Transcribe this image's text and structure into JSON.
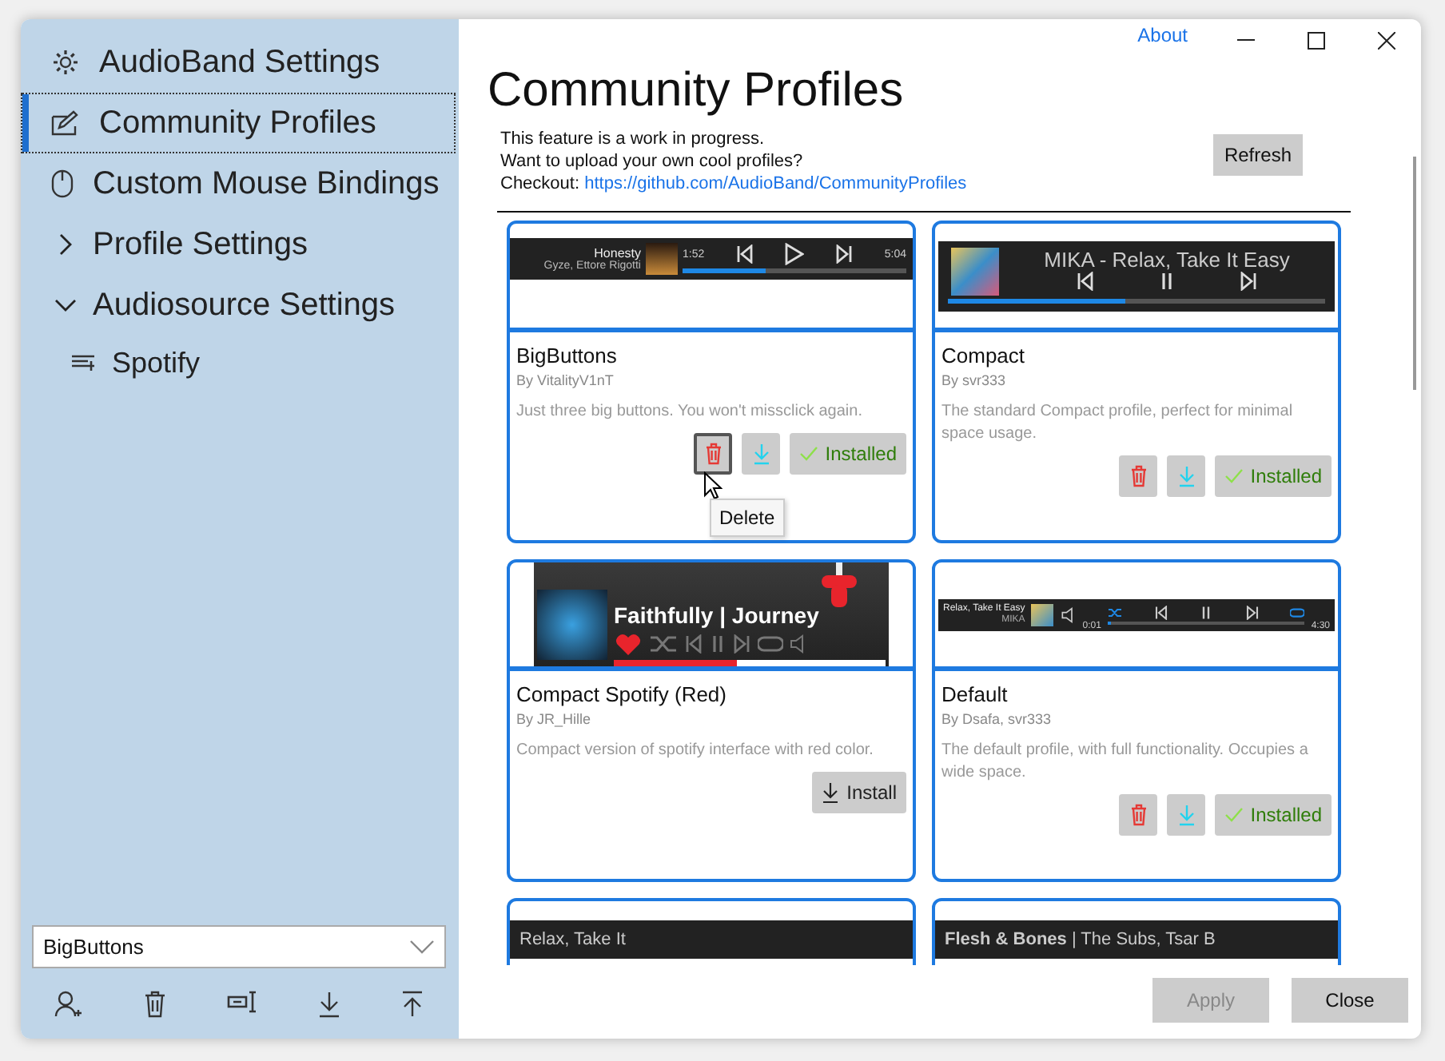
{
  "header": {
    "about_link": "About"
  },
  "sidebar": {
    "items": [
      {
        "label": "AudioBand Settings",
        "kind": "gear",
        "selected": false
      },
      {
        "label": "Community Profiles",
        "kind": "edit",
        "selected": true
      },
      {
        "label": "Custom Mouse Bindings",
        "kind": "mouse",
        "selected": false
      },
      {
        "label": "Profile Settings",
        "kind": "group",
        "selected": false,
        "expanded": false
      },
      {
        "label": "Audiosource Settings",
        "kind": "group",
        "selected": false,
        "expanded": true,
        "children": [
          {
            "label": "Spotify",
            "kind": "source",
            "selected": false
          }
        ]
      }
    ]
  },
  "profile_select": {
    "value": "BigButtons"
  },
  "content": {
    "title": "Community Profiles",
    "intro": [
      "This feature is a work in progress.",
      "Want to upload your own cool profiles?"
    ],
    "checkout_label": "Checkout:",
    "link": "https://github.com/AudioBand/CommunityProfiles",
    "refresh_button": "Refresh"
  },
  "profiles": [
    {
      "name": "BigButtons",
      "author": "By VitalityV1nT",
      "description": "Just three big buttons. You won't missclick again.",
      "installed": true,
      "installed_label": "Installed",
      "hovered": true,
      "preview": {
        "kind": "big",
        "title": "Honesty",
        "subtitle": "Gyze, Ettore Rigotti",
        "elapsed": "1:52",
        "total": "5:04",
        "level": 0.37
      }
    },
    {
      "name": "Compact",
      "author": "By svr333",
      "description": "The standard Compact profile, perfect for minimal space usage.",
      "installed": true,
      "installed_label": "Installed",
      "hovered": false,
      "preview": {
        "kind": "compact",
        "title": "MIKA - Relax, Take It Easy",
        "level": 0.47
      }
    },
    {
      "name": "Compact Spotify (Red)",
      "author": "By JR_Hille",
      "description": "Compact version of spotify interface with red color.",
      "installed": false,
      "install_label": "Install",
      "preview": {
        "kind": "spotify",
        "title": "Faithfully | Journey",
        "level": 0.45
      }
    },
    {
      "name": "Default",
      "author": "By Dsafa, svr333",
      "description": "The default profile, with full functionality. Occupies a wide space.",
      "installed": true,
      "installed_label": "Installed",
      "hovered": false,
      "preview": {
        "kind": "wide",
        "title": "Relax, Take It Easy",
        "subtitle": "MIKA",
        "elapsed": "0:01",
        "total": "4:30",
        "level": 0.02
      }
    },
    {
      "preview": {
        "kind": "strip",
        "title": "Relax, Take It"
      }
    },
    {
      "preview": {
        "kind": "strip",
        "title": "**Flesh & Bones** | The Subs, Tsar B"
      }
    }
  ],
  "tooltip": {
    "text": "Delete"
  },
  "footer": {
    "apply_button": "Apply",
    "apply_disabled": true,
    "close_button": "Close"
  }
}
